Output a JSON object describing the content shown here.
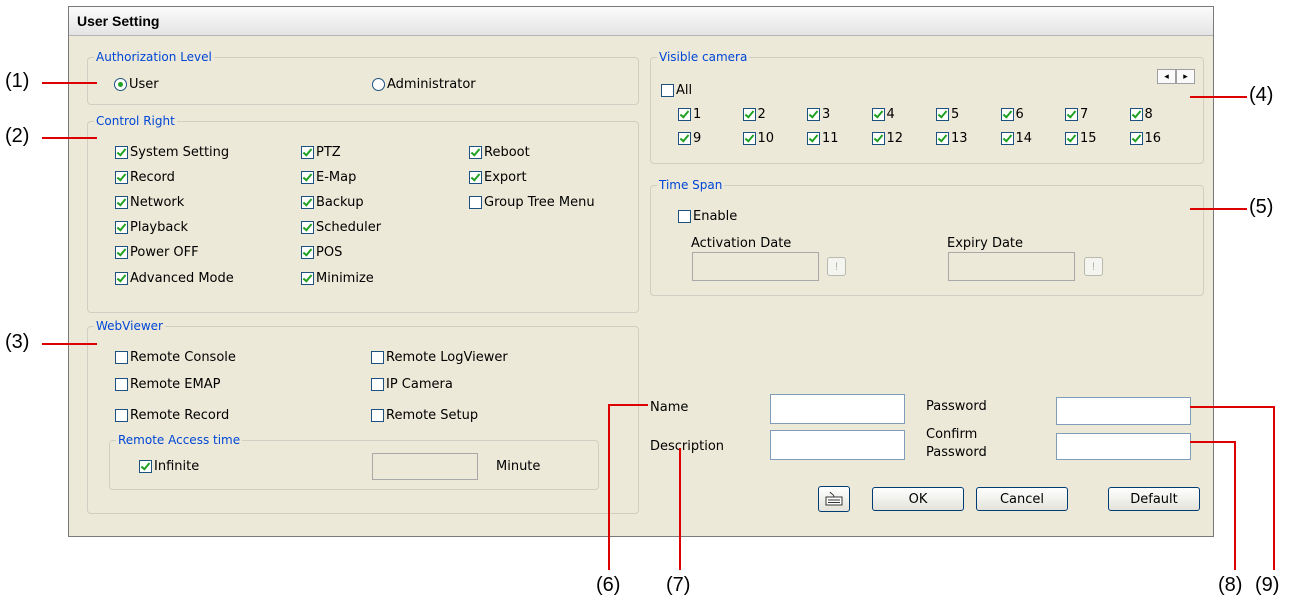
{
  "window": {
    "title": "User Setting"
  },
  "authorization": {
    "legend": "Authorization Level",
    "options": [
      {
        "label": "User",
        "selected": true
      },
      {
        "label": "Administrator",
        "selected": false
      }
    ]
  },
  "control_right": {
    "legend": "Control Right",
    "items": [
      {
        "label": "System Setting",
        "checked": true
      },
      {
        "label": "Record",
        "checked": true
      },
      {
        "label": "Network",
        "checked": true
      },
      {
        "label": "Playback",
        "checked": true
      },
      {
        "label": "Power OFF",
        "checked": true
      },
      {
        "label": "Advanced Mode",
        "checked": true
      },
      {
        "label": "PTZ",
        "checked": true
      },
      {
        "label": "E-Map",
        "checked": true
      },
      {
        "label": "Backup",
        "checked": true
      },
      {
        "label": "Scheduler",
        "checked": true
      },
      {
        "label": "POS",
        "checked": true
      },
      {
        "label": "Minimize",
        "checked": true
      },
      {
        "label": "Reboot",
        "checked": true
      },
      {
        "label": "Export",
        "checked": true
      },
      {
        "label": "Group Tree Menu",
        "checked": false
      }
    ]
  },
  "webviewer": {
    "legend": "WebViewer",
    "items": [
      {
        "label": "Remote Console",
        "checked": false
      },
      {
        "label": "Remote EMAP",
        "checked": false
      },
      {
        "label": "Remote Record",
        "checked": false
      },
      {
        "label": "Remote LogViewer",
        "checked": false
      },
      {
        "label": "IP Camera",
        "checked": false
      },
      {
        "label": "Remote Setup",
        "checked": false
      }
    ],
    "remote_access": {
      "legend": "Remote Access time",
      "infinite_label": "Infinite",
      "infinite_checked": true,
      "minutes_value": "",
      "unit_label": "Minute"
    }
  },
  "visible_camera": {
    "legend": "Visible camera",
    "all_label": "All",
    "all_checked": false,
    "cameras": [
      "1",
      "2",
      "3",
      "4",
      "5",
      "6",
      "7",
      "8",
      "9",
      "10",
      "11",
      "12",
      "13",
      "14",
      "15",
      "16"
    ],
    "arrow_left": "◂",
    "arrow_right": "▸"
  },
  "time_span": {
    "legend": "Time Span",
    "enable_label": "Enable",
    "enable_checked": false,
    "activation_label": "Activation Date",
    "expiry_label": "Expiry Date",
    "picker_glyph": "!"
  },
  "form": {
    "name_label": "Name",
    "description_label": "Description",
    "password_label": "Password",
    "confirm_label_1": "Confirm",
    "confirm_label_2": "Password",
    "name_value": "",
    "description_value": "",
    "password_value": "",
    "confirm_value": ""
  },
  "buttons": {
    "ok": "OK",
    "cancel": "Cancel",
    "default": "Default",
    "keyboard_icon": "keyboard-icon"
  },
  "callouts": [
    "(1)",
    "(2)",
    "(3)",
    "(4)",
    "(5)",
    "(6)",
    "(7)",
    "(8)",
    "(9)"
  ],
  "colors": {
    "legend": "#0046d5",
    "check": "#21a121",
    "callout_line": "#dd0000",
    "window_bg": "#ece9d8"
  }
}
